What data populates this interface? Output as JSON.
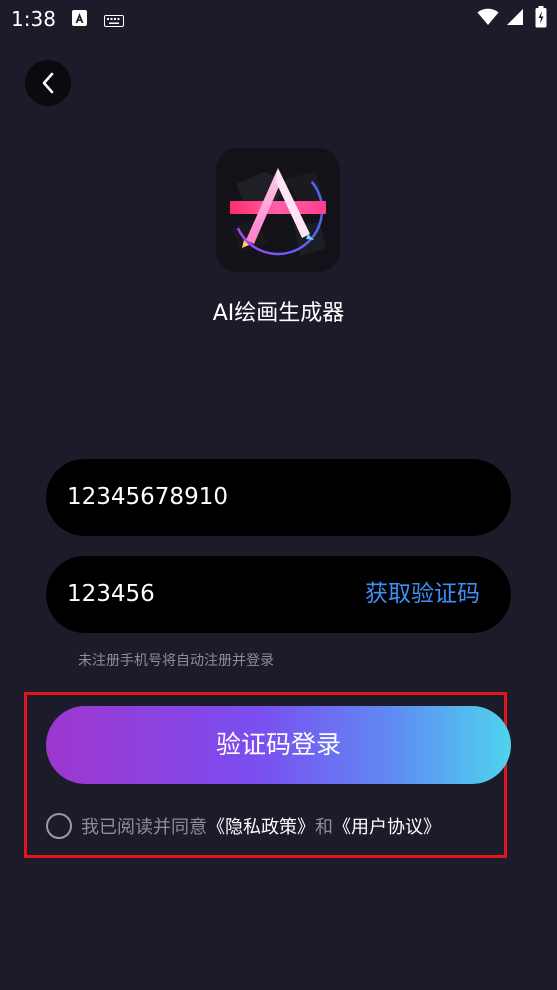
{
  "status_bar": {
    "time": "1:38"
  },
  "app": {
    "name": "AI绘画生成器"
  },
  "form": {
    "phone_value": "12345678910",
    "code_value": "123456",
    "get_code_label": "获取验证码",
    "hint": "未注册手机号将自动注册并登录",
    "login_label": "验证码登录"
  },
  "agreement": {
    "prefix": "我已阅读并同意",
    "privacy_link": "《隐私政策》",
    "conjunction": "和",
    "user_link": "《用户协议》",
    "checked": false
  },
  "colors": {
    "background": "#1c1b29",
    "link_blue": "#3d8ff5",
    "gradient_start": "#9d37ce",
    "gradient_end": "#4fd4ec",
    "highlight_red": "#e0151c"
  },
  "icons": [
    "back-chevron-icon",
    "wifi-icon",
    "signal-icon",
    "battery-icon",
    "keyboard-icon",
    "a-notification-icon"
  ]
}
